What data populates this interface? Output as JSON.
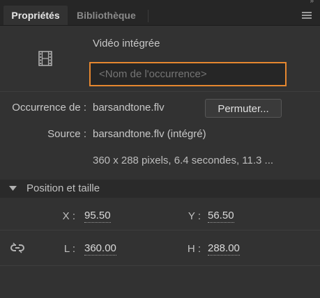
{
  "header": {
    "tabs": [
      {
        "label": "Propriétés",
        "active": true
      },
      {
        "label": "Bibliothèque",
        "active": false
      }
    ],
    "collapse_glyph": "»"
  },
  "object": {
    "type_label": "Vidéo intégrée",
    "icon": "film-icon",
    "instance_name_placeholder": "<Nom de l'occurrence>"
  },
  "properties": {
    "instance_of_label": "Occurrence de :",
    "instance_of_value": "barsandtone.flv",
    "swap_button_label": "Permuter...",
    "source_label": "Source :",
    "source_value": "barsandtone.flv (intégré)",
    "info_value": "360 x 288 pixels, 6.4 secondes, 11.3 ..."
  },
  "position_size": {
    "title": "Position et taille",
    "x_label": "X :",
    "x_value": "95.50",
    "y_label": "Y :",
    "y_value": "56.50",
    "w_label": "L :",
    "w_value": "360.00",
    "h_label": "H :",
    "h_value": "288.00",
    "link_icon": "chain-link-icon"
  },
  "colors": {
    "focus_accent": "#e6872f",
    "panel_bg": "#323232",
    "tabbar_bg": "#262626"
  }
}
